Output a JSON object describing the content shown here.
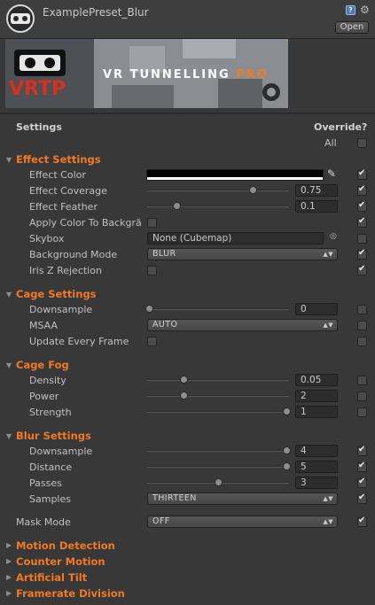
{
  "header": {
    "title": "ExamplePreset_Blur",
    "open_label": "Open",
    "help_icon_text": "?",
    "banner_logo": "VRTP",
    "banner_title": "VR TUNNELLING",
    "banner_pro": "PRO"
  },
  "columns": {
    "settings": "Settings",
    "override": "Override?",
    "all": "All",
    "all_checked": false
  },
  "effect": {
    "header": "Effect Settings",
    "color_label": "Effect Color",
    "effect_color": "#000000",
    "color_override": true,
    "coverage_label": "Effect Coverage",
    "coverage_value": "0.75",
    "coverage_fraction": 0.75,
    "coverage_override": true,
    "feather_label": "Effect Feather",
    "feather_value": "0.1",
    "feather_fraction": 0.2,
    "feather_override": true,
    "apply_color_label": "Apply Color To Backgrã",
    "apply_color_checked": false,
    "apply_color_override": true,
    "skybox_label": "Skybox",
    "skybox_value": "None (Cubemap)",
    "skybox_override": false,
    "bgmode_label": "Background Mode",
    "bgmode_value": "BLUR",
    "bgmode_override": true,
    "irisz_label": "Iris Z Rejection",
    "irisz_checked": false,
    "irisz_override": true
  },
  "cage": {
    "header": "Cage Settings",
    "downsample_label": "Downsample",
    "downsample_value": "0",
    "downsample_fraction": 0.0,
    "downsample_override": false,
    "msaa_label": "MSAA",
    "msaa_value": "AUTO",
    "msaa_override": false,
    "update_label": "Update Every Frame",
    "update_checked": false,
    "update_override": false
  },
  "fog": {
    "header": "Cage Fog",
    "density_label": "Density",
    "density_value": "0.05",
    "density_fraction": 0.25,
    "density_override": false,
    "power_label": "Power",
    "power_value": "2",
    "power_fraction": 0.25,
    "power_override": false,
    "strength_label": "Strength",
    "strength_value": "1",
    "strength_fraction": 1.0,
    "strength_override": false
  },
  "blur": {
    "header": "Blur Settings",
    "downsample_label": "Downsample",
    "downsample_value": "4",
    "downsample_fraction": 1.0,
    "downsample_override": true,
    "distance_label": "Distance",
    "distance_value": "5",
    "distance_fraction": 1.0,
    "distance_override": true,
    "passes_label": "Passes",
    "passes_value": "3",
    "passes_fraction": 0.5,
    "passes_override": true,
    "samples_label": "Samples",
    "samples_value": "THIRTEEN",
    "samples_override": true
  },
  "mask": {
    "label": "Mask Mode",
    "value": "OFF",
    "override": true
  },
  "collapsed": [
    "Motion Detection",
    "Counter Motion",
    "Artificial Tilt",
    "Framerate Division"
  ],
  "colors": {
    "accent": "#f07a24",
    "background": "#383838"
  },
  "icons": {
    "logo": "vrtp-logo-icon",
    "help": "help-icon",
    "settings": "gear-icon",
    "foldout": "triangle-right-icon",
    "dropdown": "dropdown-arrow-icon",
    "picker": "eyedropper-icon",
    "object_picker": "object-picker-icon"
  }
}
